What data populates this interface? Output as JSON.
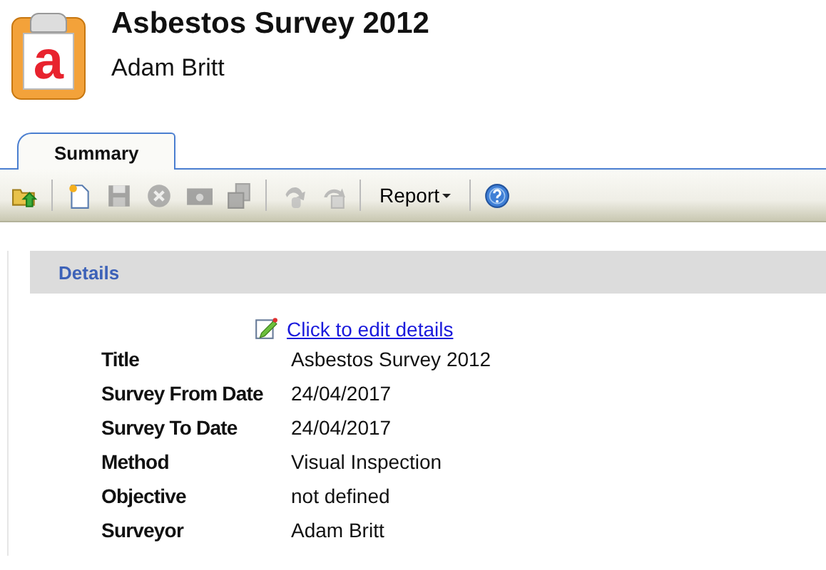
{
  "header": {
    "logo_letter": "a",
    "title": "Asbestos Survey 2012",
    "subtitle": "Adam Britt"
  },
  "tabs": [
    {
      "label": "Summary",
      "selected": true
    }
  ],
  "toolbar": [
    {
      "kind": "icon",
      "disabled": false
    },
    {
      "kind": "separator"
    },
    {
      "kind": "icon",
      "disabled": false
    },
    {
      "kind": "icon",
      "disabled": true
    },
    {
      "kind": "icon",
      "disabled": true
    },
    {
      "kind": "icon",
      "disabled": true
    },
    {
      "kind": "icon",
      "disabled": true
    },
    {
      "kind": "separator"
    },
    {
      "kind": "icon",
      "disabled": true
    },
    {
      "kind": "icon",
      "disabled": true
    },
    {
      "kind": "separator"
    },
    {
      "kind": "menu",
      "label": "Report"
    },
    {
      "kind": "separator"
    },
    {
      "kind": "icon",
      "disabled": false
    }
  ],
  "details": {
    "heading": "Details",
    "edit_link": "Click to edit details",
    "fields": [
      {
        "label": "Title",
        "value": "Asbestos Survey 2012"
      },
      {
        "label": "Survey From Date",
        "value": "24/04/2017"
      },
      {
        "label": "Survey To Date",
        "value": "24/04/2017"
      },
      {
        "label": "Method",
        "value": "Visual Inspection"
      },
      {
        "label": "Objective",
        "value": "not defined"
      },
      {
        "label": "Surveyor",
        "value": "Adam Britt"
      }
    ]
  }
}
